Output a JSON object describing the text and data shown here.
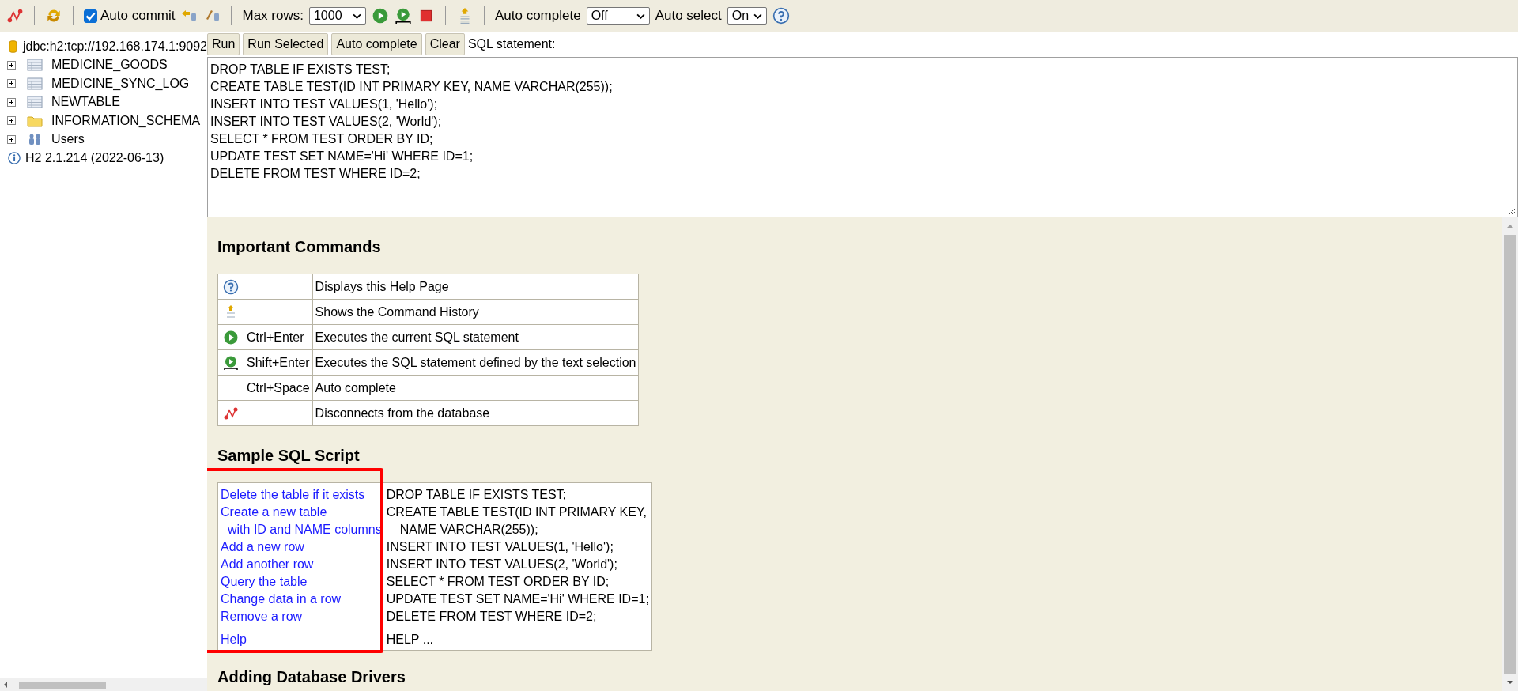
{
  "toolbar": {
    "auto_commit": {
      "label": "Auto commit",
      "checked": true
    },
    "max_rows": {
      "label": "Max rows:",
      "value": "1000"
    },
    "auto_complete": {
      "label": "Auto complete",
      "value": "Off"
    },
    "auto_select": {
      "label": "Auto select",
      "value": "On"
    }
  },
  "sidebar": {
    "connection": "jdbc:h2:tcp://192.168.174.1:9092",
    "tree": [
      {
        "kind": "table",
        "label": "MEDICINE_GOODS",
        "expanded": false
      },
      {
        "kind": "table",
        "label": "MEDICINE_SYNC_LOG",
        "expanded": false
      },
      {
        "kind": "table",
        "label": "NEWTABLE",
        "expanded": false
      },
      {
        "kind": "folder",
        "label": "INFORMATION_SCHEMA",
        "expanded": false
      },
      {
        "kind": "users",
        "label": "Users",
        "expanded": false
      }
    ],
    "version": "H2 2.1.214 (2022-06-13)"
  },
  "editor": {
    "buttons": [
      "Run",
      "Run Selected",
      "Auto complete",
      "Clear"
    ],
    "label": "SQL statement:",
    "lines": [
      "DROP TABLE IF EXISTS TEST;",
      "CREATE TABLE TEST(ID INT PRIMARY KEY, NAME VARCHAR(255));",
      "INSERT INTO TEST VALUES(1, 'Hello');",
      "INSERT INTO TEST VALUES(2, 'World');",
      "SELECT * FROM TEST ORDER BY ID;",
      "UPDATE TEST SET NAME='Hi' WHERE ID=1;",
      "DELETE FROM TEST WHERE ID=2;"
    ]
  },
  "help": {
    "commands_title": "Important Commands",
    "commands": [
      {
        "description": "Displays this Help Page"
      },
      {
        "description": "Shows the Command History"
      },
      {
        "shortcut": "Ctrl+Enter",
        "description": "Executes the current SQL statement"
      },
      {
        "shortcut": "Shift+Enter",
        "description": "Executes the SQL statement defined by the text selection"
      },
      {
        "shortcut": "Ctrl+Space",
        "description": "Auto complete"
      },
      {
        "description": "Disconnects from the database"
      }
    ],
    "sample_title": "Sample SQL Script",
    "sample_highlighted": true,
    "sample": [
      {
        "link": "Delete the table if it exists",
        "sql": "DROP TABLE IF EXISTS TEST;"
      },
      {
        "link": "Create a new table",
        "sql": "CREATE TABLE TEST(ID INT PRIMARY KEY,"
      },
      {
        "link": "with ID and NAME columns",
        "sql": "NAME VARCHAR(255));",
        "indent": true
      },
      {
        "link": "Add a new row",
        "sql": "INSERT INTO TEST VALUES(1, 'Hello');"
      },
      {
        "link": "Add another row",
        "sql": "INSERT INTO TEST VALUES(2, 'World');"
      },
      {
        "link": "Query the table",
        "sql": "SELECT * FROM TEST ORDER BY ID;"
      },
      {
        "link": "Change data in a row",
        "sql": "UPDATE TEST SET NAME='Hi' WHERE ID=1;"
      },
      {
        "link": "Remove a row",
        "sql": "DELETE FROM TEST WHERE ID=2;"
      }
    ],
    "sample_help": {
      "link": "Help",
      "sql": "HELP ..."
    },
    "drivers_title": "Adding Database Drivers"
  }
}
